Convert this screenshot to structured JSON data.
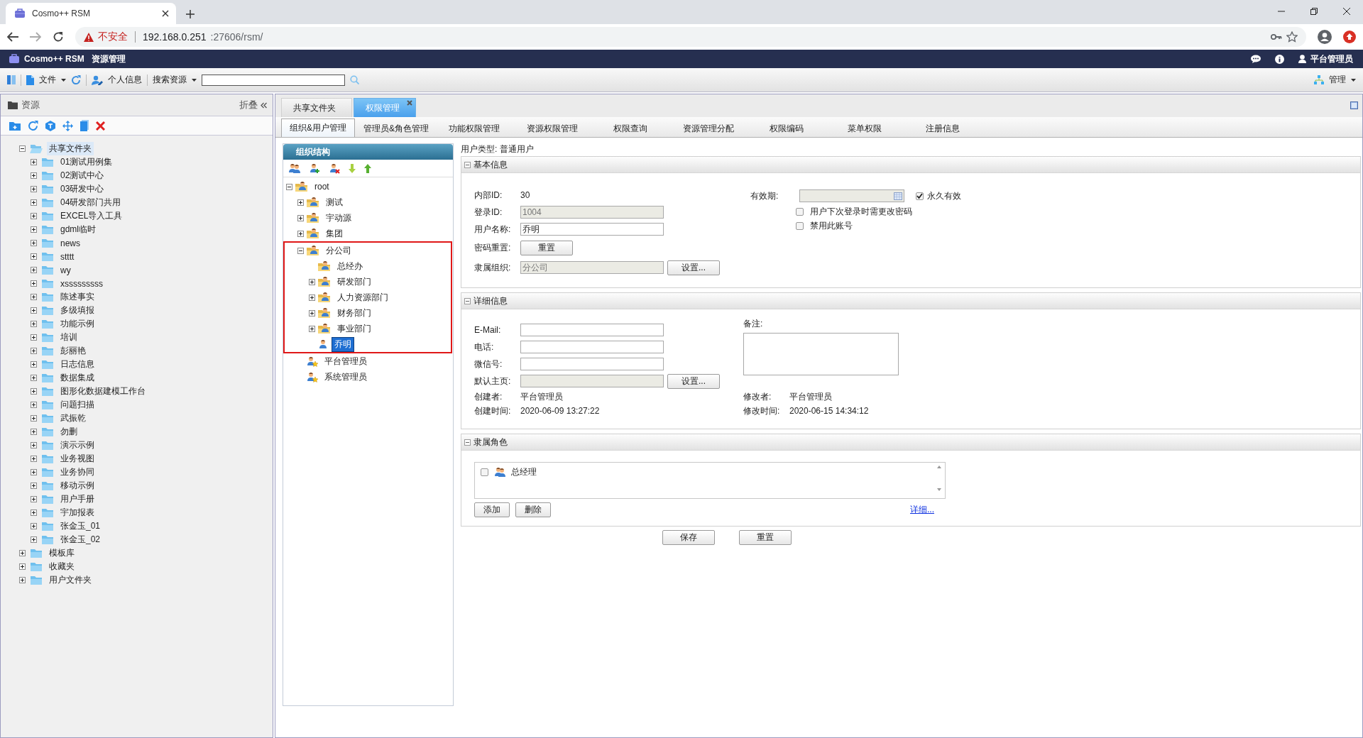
{
  "browser": {
    "tab_title": "Cosmo++ RSM",
    "security_label": "不安全",
    "url_host": "192.168.0.251",
    "url_path": ":27606/rsm/"
  },
  "app_header": {
    "product": "Cosmo++ RSM",
    "module": "资源管理",
    "user": "平台管理员"
  },
  "toolbar": {
    "file_menu": "文件",
    "profile": "个人信息",
    "search_menu": "搜索资源",
    "manage_menu": "管理"
  },
  "resource_panel": {
    "title": "资源",
    "collapse": "折叠",
    "tree": [
      {
        "label": "共享文件夹",
        "expanded": true,
        "selected": true,
        "children": [
          {
            "label": "01测试用例集",
            "expanded": false,
            "selected": false
          },
          {
            "label": "02测试中心",
            "expanded": false,
            "selected": false
          },
          {
            "label": "03研发中心",
            "expanded": false,
            "selected": false
          },
          {
            "label": "04研发部门共用",
            "expanded": false,
            "selected": false
          },
          {
            "label": "EXCEL导入工具",
            "expanded": false,
            "selected": false
          },
          {
            "label": "gdml临时",
            "expanded": false,
            "selected": false
          },
          {
            "label": "news",
            "expanded": false,
            "selected": false
          },
          {
            "label": "stttt",
            "expanded": false,
            "selected": false
          },
          {
            "label": "wy",
            "expanded": false,
            "selected": false
          },
          {
            "label": "xsssssssss",
            "expanded": false,
            "selected": false
          },
          {
            "label": "陈述事实",
            "expanded": false,
            "selected": false
          },
          {
            "label": "多级填报",
            "expanded": false,
            "selected": false
          },
          {
            "label": "功能示例",
            "expanded": false,
            "selected": false
          },
          {
            "label": "培训",
            "expanded": false,
            "selected": false
          },
          {
            "label": "彭丽艳",
            "expanded": false,
            "selected": false
          },
          {
            "label": "日志信息",
            "expanded": false,
            "selected": false
          },
          {
            "label": "数据集成",
            "expanded": false,
            "selected": false
          },
          {
            "label": "图形化数据建模工作台",
            "expanded": false,
            "selected": false
          },
          {
            "label": "问题扫描",
            "expanded": false,
            "selected": false
          },
          {
            "label": "武振乾",
            "expanded": false,
            "selected": false
          },
          {
            "label": "勿删",
            "expanded": false,
            "selected": false
          },
          {
            "label": "演示示例",
            "expanded": false,
            "selected": false
          },
          {
            "label": "业务视图",
            "expanded": false,
            "selected": false
          },
          {
            "label": "业务协同",
            "expanded": false,
            "selected": false
          },
          {
            "label": "移动示例",
            "expanded": false,
            "selected": false
          },
          {
            "label": "用户手册",
            "expanded": false,
            "selected": false
          },
          {
            "label": "宇加报表",
            "expanded": false,
            "selected": false
          },
          {
            "label": "张金玉_01",
            "expanded": false,
            "selected": false
          },
          {
            "label": "张金玉_02",
            "expanded": false,
            "selected": false
          }
        ]
      },
      {
        "label": "模板库",
        "expanded": false,
        "selected": false
      },
      {
        "label": "收藏夹",
        "expanded": false,
        "selected": false
      },
      {
        "label": "用户文件夹",
        "expanded": false,
        "selected": false
      }
    ]
  },
  "tabs": [
    {
      "label": "共享文件夹",
      "selected": false,
      "closable": false
    },
    {
      "label": "权限管理",
      "selected": true,
      "closable": true
    }
  ],
  "subtabs": [
    {
      "label": "组织&用户管理",
      "selected": true
    },
    {
      "label": "管理员&角色管理",
      "selected": false
    },
    {
      "label": "功能权限管理",
      "selected": false
    },
    {
      "label": "资源权限管理",
      "selected": false
    },
    {
      "label": "权限查询",
      "selected": false
    },
    {
      "label": "资源管理分配",
      "selected": false
    },
    {
      "label": "权限编码",
      "selected": false
    },
    {
      "label": "菜单权限",
      "selected": false
    },
    {
      "label": "注册信息",
      "selected": false
    }
  ],
  "org_panel": {
    "title": "组织结构",
    "tree": [
      {
        "label": "root",
        "kind": "org",
        "expanded": true,
        "selected": false,
        "children": [
          {
            "label": "测试",
            "kind": "org",
            "expanded": false,
            "selected": false,
            "highlighted": false
          },
          {
            "label": "宇动源",
            "kind": "org",
            "expanded": false,
            "selected": false,
            "highlighted": false
          },
          {
            "label": "集团",
            "kind": "org",
            "expanded": false,
            "selected": false,
            "highlighted": false
          },
          {
            "label": "分公司",
            "kind": "org",
            "expanded": true,
            "selected": false,
            "highlighted": true,
            "children": [
              {
                "label": "总经办",
                "kind": "org",
                "selected": false
              },
              {
                "label": "研发部门",
                "kind": "org",
                "expanded": false,
                "selected": false
              },
              {
                "label": "人力资源部门",
                "kind": "org",
                "expanded": false,
                "selected": false
              },
              {
                "label": "财务部门",
                "kind": "org",
                "expanded": false,
                "selected": false
              },
              {
                "label": "事业部门",
                "kind": "org",
                "expanded": false,
                "selected": false
              },
              {
                "label": "乔明",
                "kind": "user",
                "selected": true
              }
            ]
          },
          {
            "label": "平台管理员",
            "kind": "admin",
            "selected": false,
            "highlighted": false
          },
          {
            "label": "系统管理员",
            "kind": "admin",
            "selected": false,
            "highlighted": false
          }
        ]
      }
    ]
  },
  "user_form": {
    "user_type": "用户类型: 普通用户",
    "basic_info": {
      "title": "基本信息",
      "expanded": true,
      "internal_id": {
        "label": "内部ID:",
        "value": "30"
      },
      "login_id": {
        "label": "登录ID:",
        "value": "1004",
        "disabled": true
      },
      "user_name": {
        "label": "用户名称:",
        "value": "乔明",
        "disabled": false
      },
      "password_reset": {
        "label": "密码重置:",
        "button": "重置"
      },
      "organization": {
        "label": "隶属组织:",
        "value": "分公司",
        "disabled": true,
        "button": "设置..."
      },
      "validity": {
        "label": "有效期:",
        "disabled": true,
        "permanent": {
          "label": "永久有效",
          "checked": true
        }
      },
      "options": [
        {
          "label": "用户下次登录时需更改密码",
          "checked": false
        },
        {
          "label": "禁用此账号",
          "checked": false
        }
      ]
    },
    "detail_info": {
      "title": "详细信息",
      "expanded": true,
      "fields": [
        {
          "label": "E-Mail:",
          "disabled": false
        },
        {
          "label": "电话:",
          "disabled": false
        },
        {
          "label": "微信号:",
          "disabled": false
        },
        {
          "label": "默认主页:",
          "disabled": true,
          "button": "设置..."
        }
      ],
      "remarks_label": "备注:",
      "creator": {
        "label": "创建者:",
        "value": "平台管理员"
      },
      "created": {
        "label": "创建时间:",
        "value": "2020-06-09 13:27:22"
      },
      "modifier": {
        "label": "修改者:",
        "value": "平台管理员"
      },
      "modified": {
        "label": "修改时间:",
        "value": "2020-06-15 14:34:12"
      }
    },
    "roles": {
      "title": "隶属角色",
      "expanded": true,
      "items": [
        {
          "label": "总经理",
          "checked": false
        }
      ],
      "buttons": [
        "添加",
        "删除"
      ],
      "details_link": "详细..."
    },
    "actions": [
      "保存",
      "重置"
    ]
  }
}
